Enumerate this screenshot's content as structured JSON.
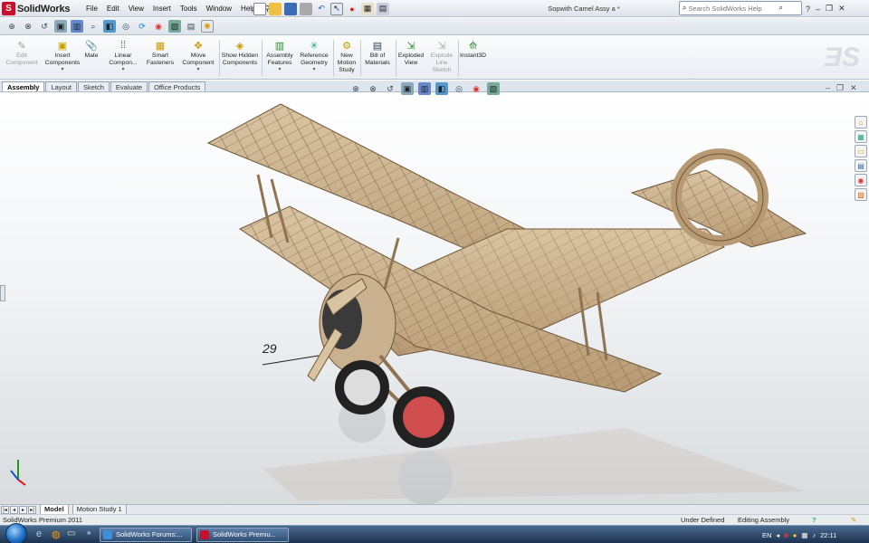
{
  "app": {
    "logo_text": "SolidWorks",
    "document_title": "Sopwith Camel Assy a *"
  },
  "menu": [
    "File",
    "Edit",
    "View",
    "Insert",
    "Tools",
    "Window",
    "Help"
  ],
  "help_search": {
    "placeholder": "Search SolidWorks Help"
  },
  "command_manager": {
    "edit_component": "Edit Component",
    "insert_components": "Insert Components",
    "mate": "Mate",
    "linear_component": "Linear Compon...",
    "smart_fasteners": "Smart Fasteners",
    "move_component": "Move Component",
    "show_hidden_components": "Show Hidden Components",
    "assembly_features": "Assembly Features",
    "reference_geometry": "Reference Geometry",
    "new_motion_study": "New Motion Study",
    "bill_of_materials": "Bill of Materials",
    "exploded_view": "Exploded View",
    "explode_line_sketch": "Explode Line Sketch",
    "instant3d": "Instant3D"
  },
  "tabs": [
    "Assembly",
    "Layout",
    "Sketch",
    "Evaluate",
    "Office Products"
  ],
  "graphics": {
    "balloon_label": "29"
  },
  "bottom_tabs": [
    "Model",
    "Motion Study 1"
  ],
  "status": {
    "product": "SolidWorks Premium 2011",
    "state": "Under Defined",
    "mode": "Editing Assembly"
  },
  "taskbar": {
    "tasks": [
      "SolidWorks Forums:...",
      "SolidWorks Premiu..."
    ],
    "language": "EN",
    "clock": "22:11"
  },
  "colors": {
    "brand_red": "#c8102e",
    "model_wood": "#c9b190",
    "wheel_hub": "#cf4d4d"
  },
  "icons": [
    "search-icon",
    "home-icon",
    "folder-icon",
    "help-icon",
    "new-file-icon",
    "open-icon",
    "save-icon",
    "print-icon",
    "undo-icon",
    "select-arrow-icon",
    "zoom-icon",
    "rebuild-icon",
    "options-icon",
    "appearance-icon"
  ]
}
